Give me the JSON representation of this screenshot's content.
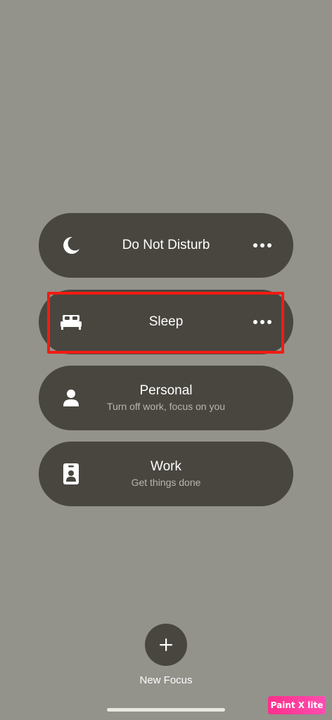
{
  "focus_modes": [
    {
      "name": "Do Not Disturb",
      "subtitle": "",
      "icon": "moon-icon",
      "has_more": true
    },
    {
      "name": "Sleep",
      "subtitle": "",
      "icon": "bed-icon",
      "has_more": true,
      "highlighted": true
    },
    {
      "name": "Personal",
      "subtitle": "Turn off work, focus on you",
      "icon": "person-icon",
      "has_more": false
    },
    {
      "name": "Work",
      "subtitle": "Get things done",
      "icon": "id-badge-icon",
      "has_more": false
    }
  ],
  "new_focus": {
    "label": "New Focus",
    "icon": "plus-icon"
  },
  "watermark": {
    "text": "Paint X lite"
  },
  "colors": {
    "background": "#93928b",
    "pill": "#48463f",
    "highlight": "#f21b12",
    "subtitle": "#b8b6ad"
  }
}
